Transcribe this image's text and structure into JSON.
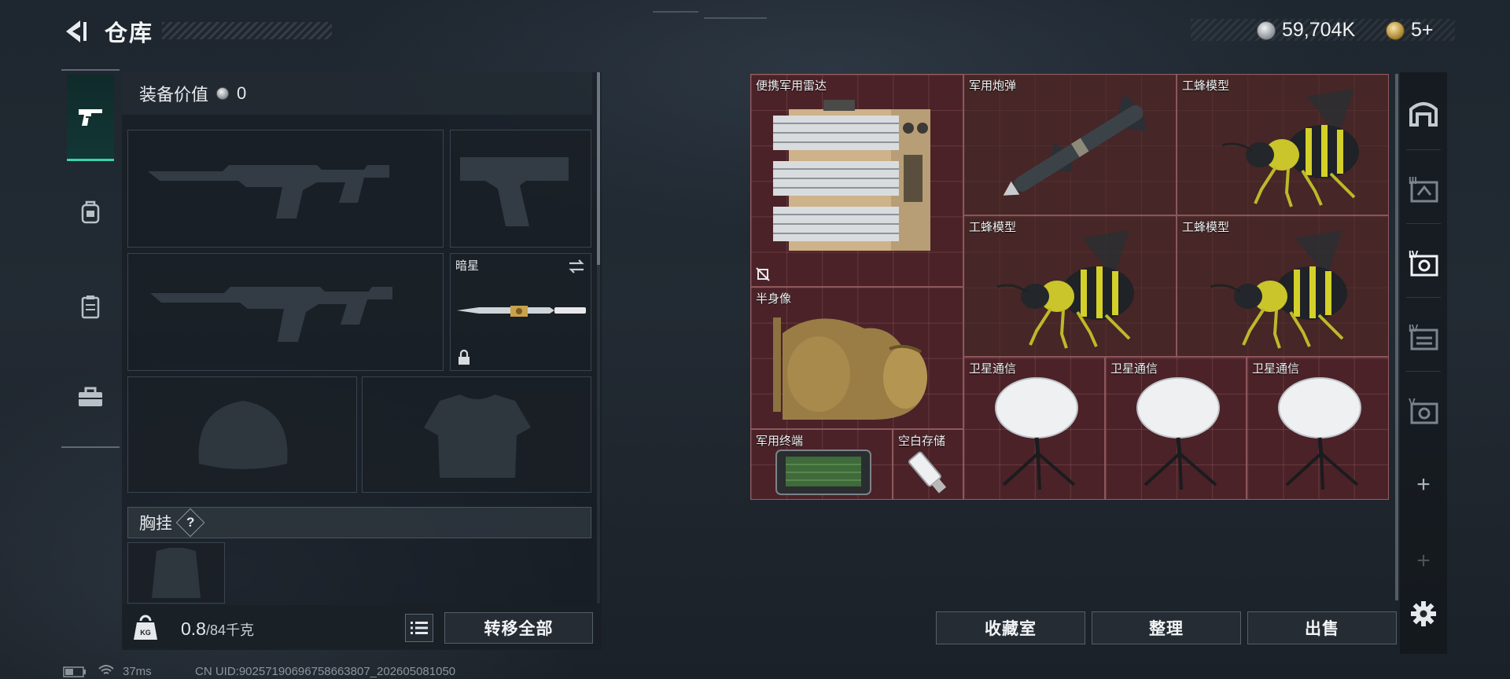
{
  "header": {
    "title": "仓库"
  },
  "currency": {
    "silver": "59,704K",
    "gold": "5+"
  },
  "equipment": {
    "value_label": "装备价值",
    "value": "0",
    "melee_slot": {
      "name": "暗星"
    },
    "chest_label": "胸挂",
    "help_glyph": "?"
  },
  "footer": {
    "weight_current": "0.8",
    "weight_max": "/84千克",
    "weight_icon_text": "KG",
    "transfer_all": "转移全部",
    "collection": "收藏室",
    "organize": "整理",
    "sell": "出售"
  },
  "storage_items": [
    {
      "name": "便携军用雷达",
      "icon": "radar"
    },
    {
      "name": "军用炮弹",
      "icon": "missile"
    },
    {
      "name": "工蜂模型",
      "icon": "bee"
    },
    {
      "name": "工蜂模型",
      "icon": "bee"
    },
    {
      "name": "工蜂模型",
      "icon": "bee"
    },
    {
      "name": "半身像",
      "icon": "bust"
    },
    {
      "name": "卫星通信",
      "icon": "satellite-dish"
    },
    {
      "name": "卫星通信",
      "icon": "satellite-dish"
    },
    {
      "name": "卫星通信",
      "icon": "satellite-dish"
    },
    {
      "name": "军用终端",
      "icon": "terminal"
    },
    {
      "name": "空白存储",
      "icon": "usb-drive"
    }
  ],
  "right_tabs": [
    "warehouse-icon",
    "tab-III",
    "tab-IV",
    "tab-IV-b",
    "tab-V"
  ],
  "status_bar": {
    "ping": "37ms",
    "uid": "CN UID:9025719069675866380​7_202605081050"
  },
  "colors": {
    "accent": "#3ad3a8",
    "storage_bg": "#4b2228"
  }
}
